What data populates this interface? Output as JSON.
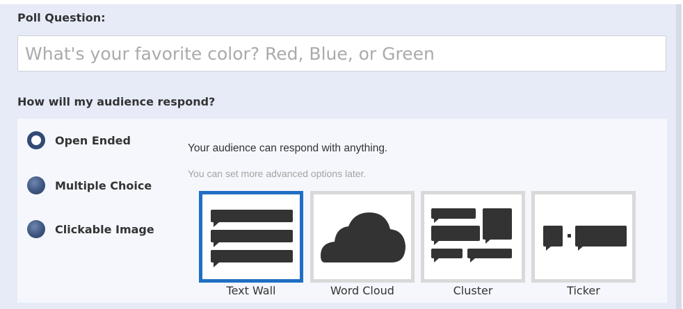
{
  "poll": {
    "question_label": "Poll Question:",
    "question_placeholder": "What's your favorite color? Red, Blue, or Green",
    "question_value": ""
  },
  "response": {
    "label": "How will my audience respond?",
    "types": [
      {
        "label": "Open Ended",
        "selected": true
      },
      {
        "label": "Multiple Choice",
        "selected": false
      },
      {
        "label": "Clickable Image",
        "selected": false
      }
    ],
    "description": "Your audience can respond with anything.",
    "subdescription": "You can set more advanced options later."
  },
  "display_styles": [
    {
      "label": "Text Wall",
      "icon": "text-wall-icon",
      "selected": true
    },
    {
      "label": "Word Cloud",
      "icon": "word-cloud-icon",
      "selected": false
    },
    {
      "label": "Cluster",
      "icon": "cluster-icon",
      "selected": false
    },
    {
      "label": "Ticker",
      "icon": "ticker-icon",
      "selected": false
    }
  ],
  "colors": {
    "panel_bg": "#e7ebf8",
    "selected_border": "#1f6fc4",
    "tile_border": "#d9d9d9",
    "icon_fill": "#333333",
    "radio_fill": "#3d5580"
  }
}
